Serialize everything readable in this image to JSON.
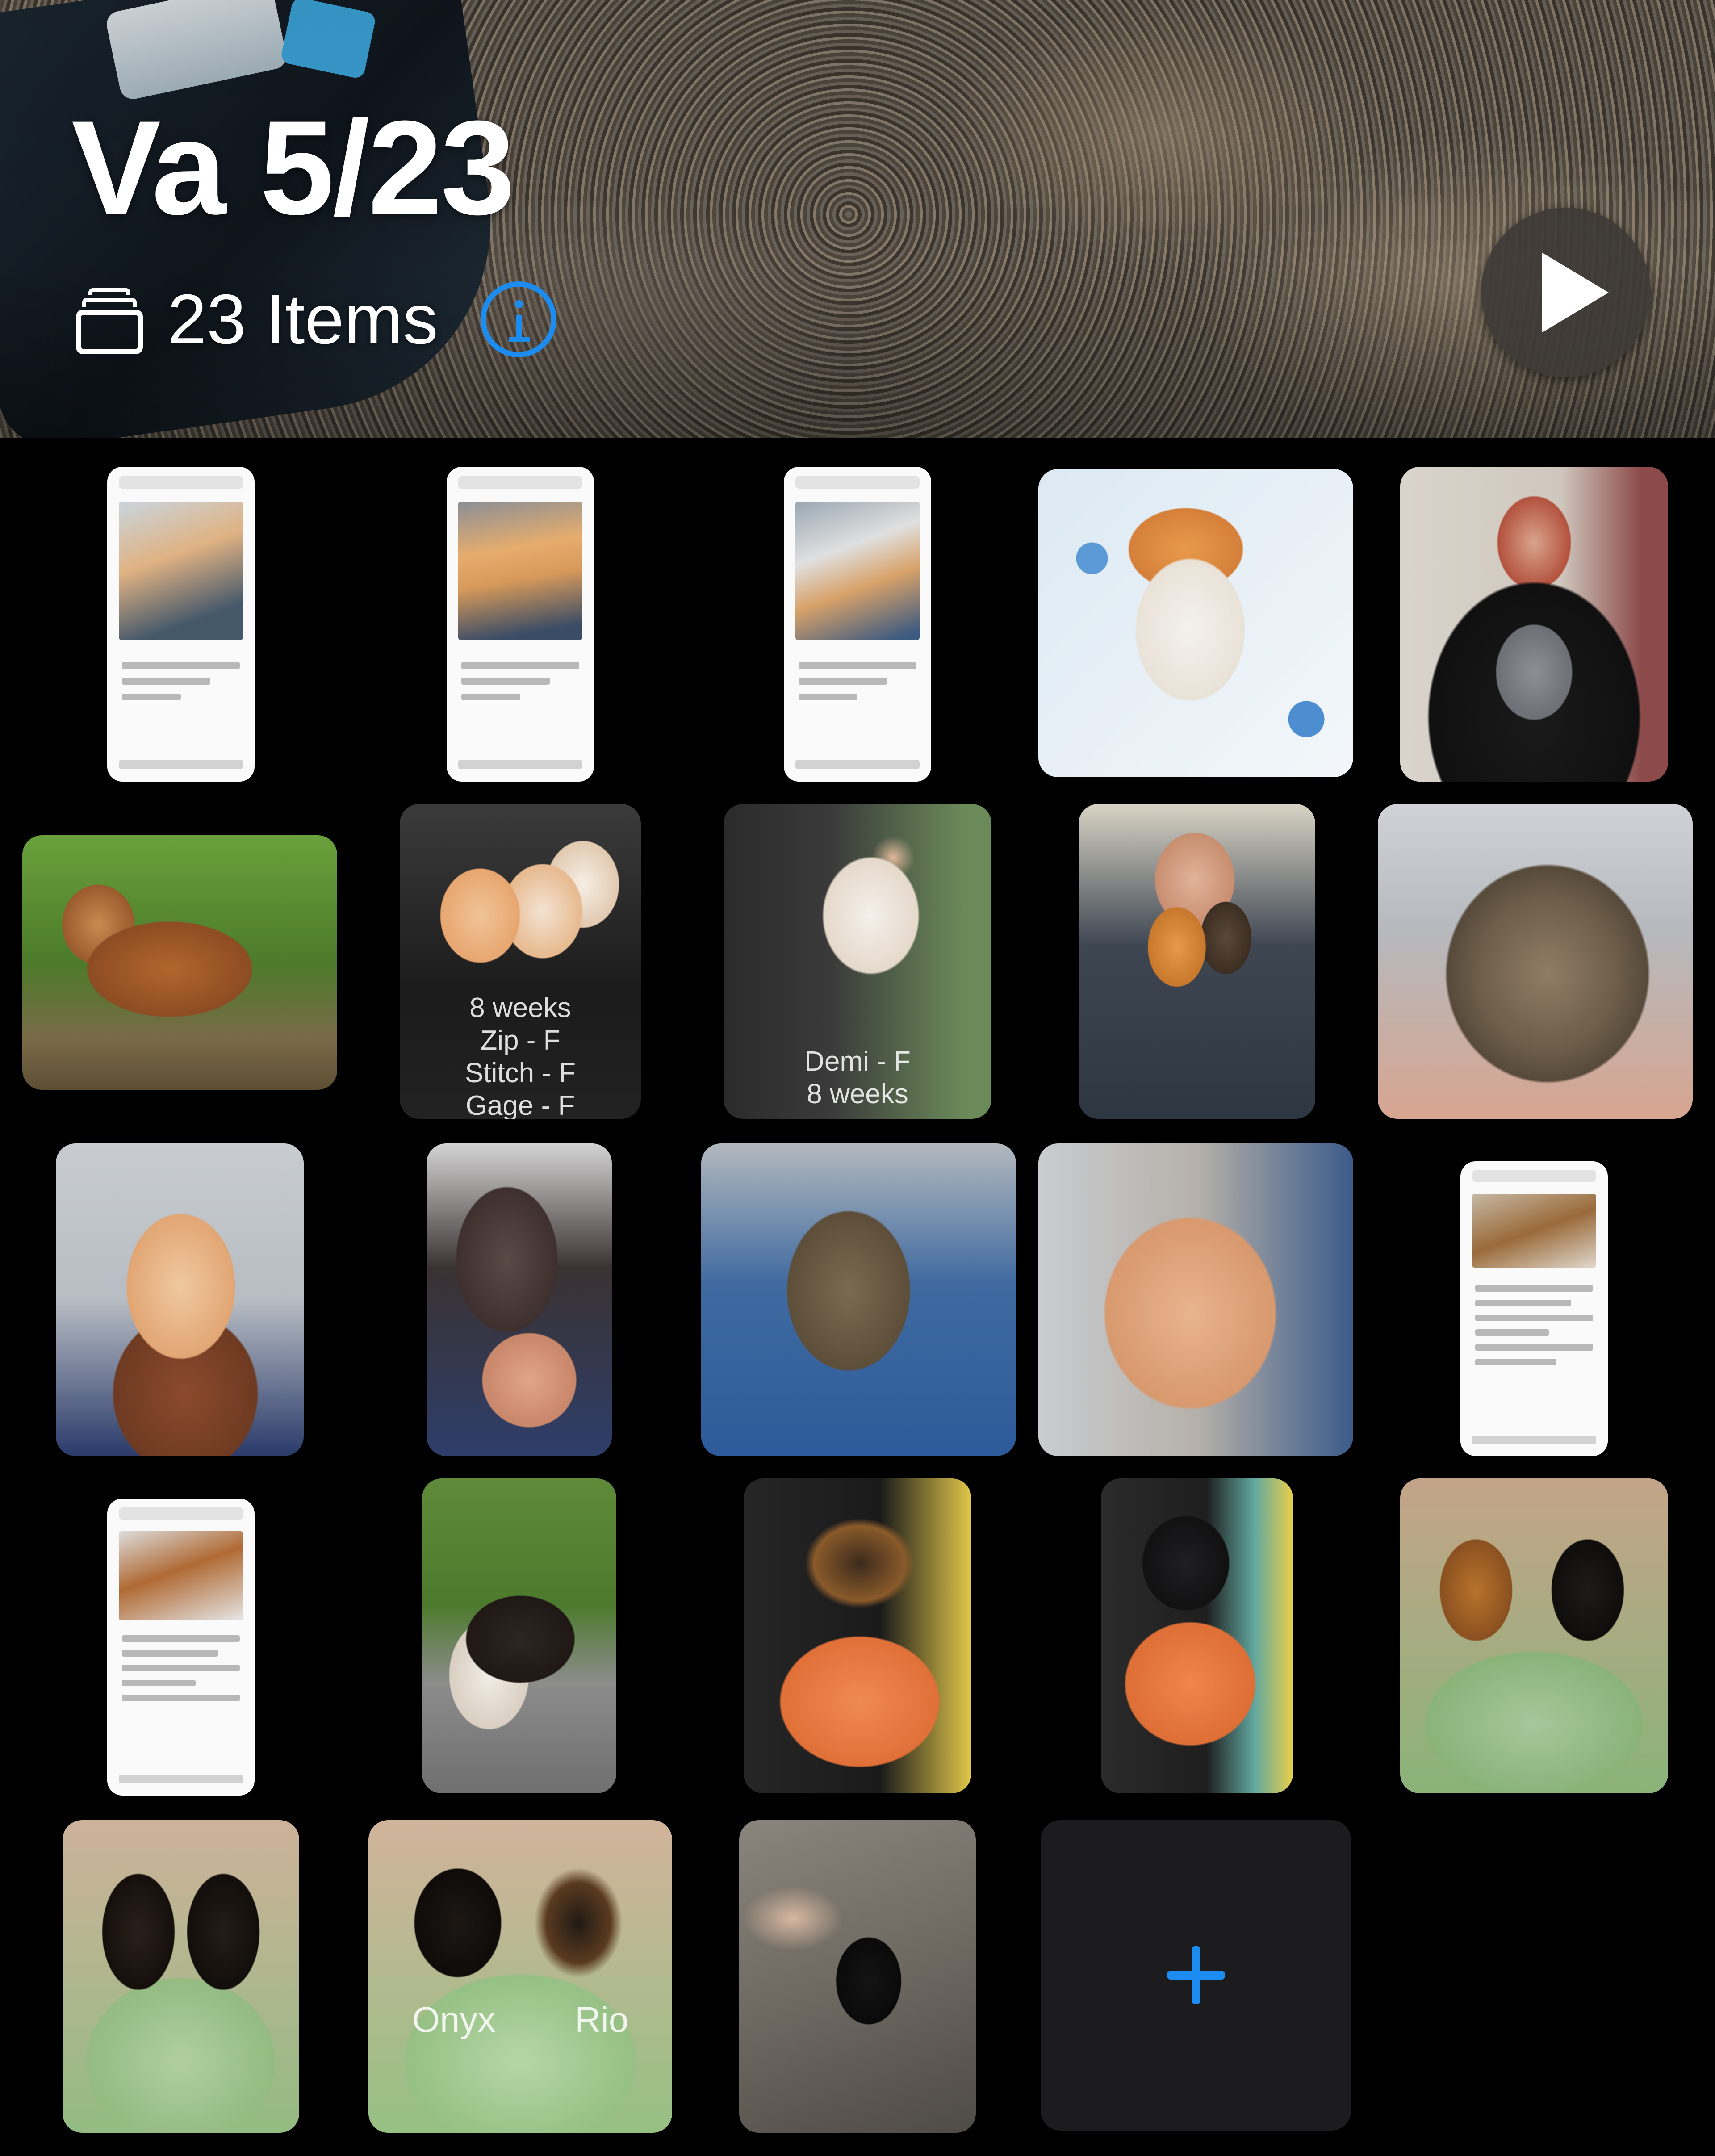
{
  "header": {
    "album_title": "Va 5/23",
    "item_count": "23 Items",
    "stack_icon": "photo-stack-icon",
    "info_icon": "info-circle-icon",
    "play_icon": "play-icon",
    "accent_color": "#1d8cf0"
  },
  "grid": {
    "items": [
      {
        "kind": "screenshot",
        "subject": "kitten listing"
      },
      {
        "kind": "screenshot",
        "subject": "kitten listing"
      },
      {
        "kind": "screenshot",
        "subject": "kitten listing"
      },
      {
        "kind": "photo",
        "subject": "orange and white kitten"
      },
      {
        "kind": "photo",
        "subject": "woman holding grey kitten"
      },
      {
        "kind": "photo",
        "subject": "beagle on grass"
      },
      {
        "kind": "photo",
        "subject": "three kittens held",
        "caption": "8 weeks\nZip - F\nStitch - F\nGage - F"
      },
      {
        "kind": "photo",
        "subject": "white kitten held",
        "caption": "Demi - F\n8 weeks"
      },
      {
        "kind": "photo",
        "subject": "man holding two kittens"
      },
      {
        "kind": "photo",
        "subject": "tabby kitten close-up"
      },
      {
        "kind": "photo",
        "subject": "orange kitten held"
      },
      {
        "kind": "photo",
        "subject": "dark kitten in hand"
      },
      {
        "kind": "photo",
        "subject": "tabby cat on blue mat"
      },
      {
        "kind": "photo",
        "subject": "orange kitten close-up"
      },
      {
        "kind": "screenshot",
        "subject": "dog listing"
      },
      {
        "kind": "screenshot",
        "subject": "puppy listing"
      },
      {
        "kind": "photo",
        "subject": "beagle puppy on path"
      },
      {
        "kind": "photo",
        "subject": "shepherd puppy held"
      },
      {
        "kind": "photo",
        "subject": "black puppy held"
      },
      {
        "kind": "photo",
        "subject": "two shepherd puppies held"
      },
      {
        "kind": "photo",
        "subject": "two black puppies held"
      },
      {
        "kind": "photo",
        "subject": "two puppies held",
        "caption": "Onyx        Rio"
      },
      {
        "kind": "photo",
        "subject": "black kitten on rock"
      }
    ],
    "add_icon": "plus-icon"
  }
}
